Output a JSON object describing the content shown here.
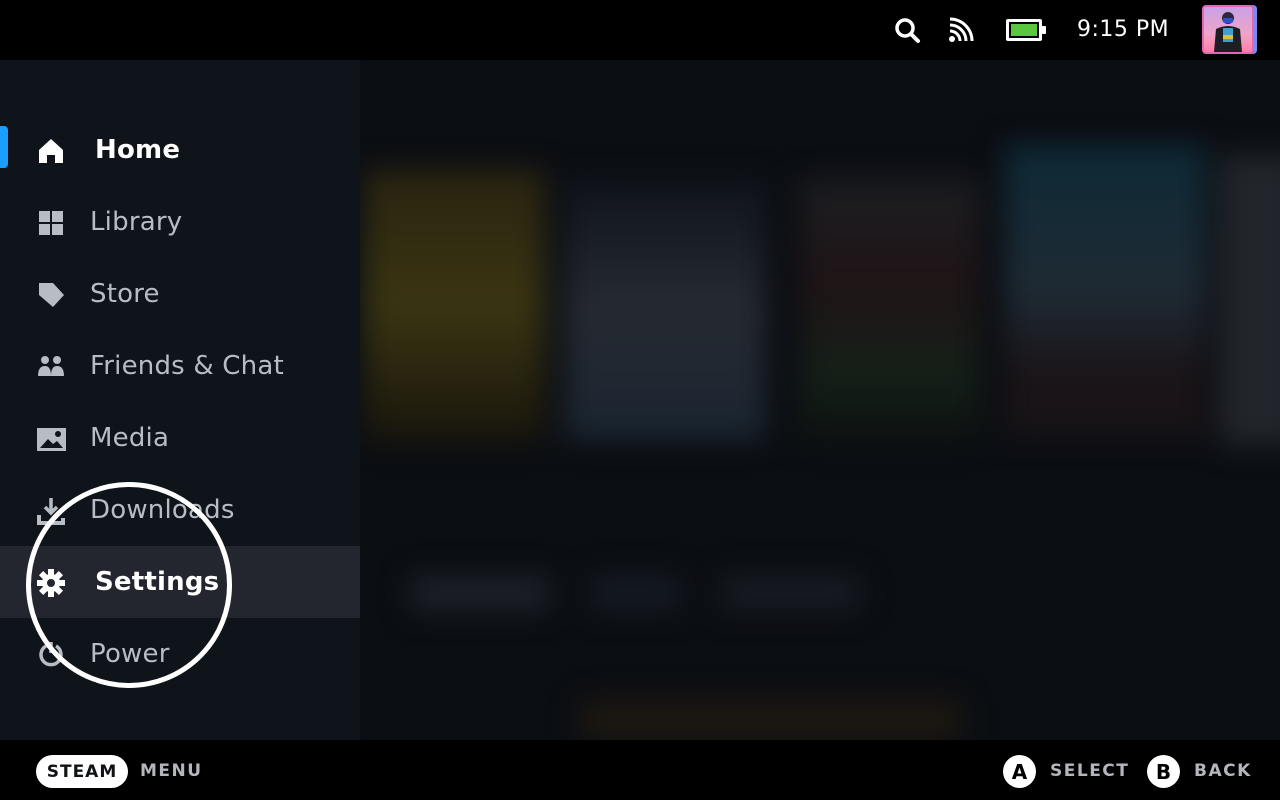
{
  "status_bar": {
    "icons": [
      "search-icon",
      "cast-icon",
      "battery-icon"
    ],
    "battery_color": "#5bc63e",
    "time": "9:15 PM",
    "avatar": "user-avatar"
  },
  "sidebar": {
    "accent_color": "#1a9fff",
    "items": [
      {
        "label": "Home",
        "icon": "home-icon",
        "state": "active"
      },
      {
        "label": "Library",
        "icon": "grid-icon",
        "state": "normal"
      },
      {
        "label": "Store",
        "icon": "tag-icon",
        "state": "normal"
      },
      {
        "label": "Friends & Chat",
        "icon": "friends-icon",
        "state": "normal"
      },
      {
        "label": "Media",
        "icon": "image-icon",
        "state": "normal"
      },
      {
        "label": "Downloads",
        "icon": "download-icon",
        "state": "normal"
      },
      {
        "label": "Settings",
        "icon": "gear-icon",
        "state": "focused"
      },
      {
        "label": "Power",
        "icon": "power-icon",
        "state": "normal"
      }
    ],
    "annotation": "highlight-circle around Settings"
  },
  "footer": {
    "steam_button": "STEAM",
    "menu_label": "MENU",
    "select_glyph": "A",
    "select_label": "SELECT",
    "back_glyph": "B",
    "back_label": "BACK"
  }
}
